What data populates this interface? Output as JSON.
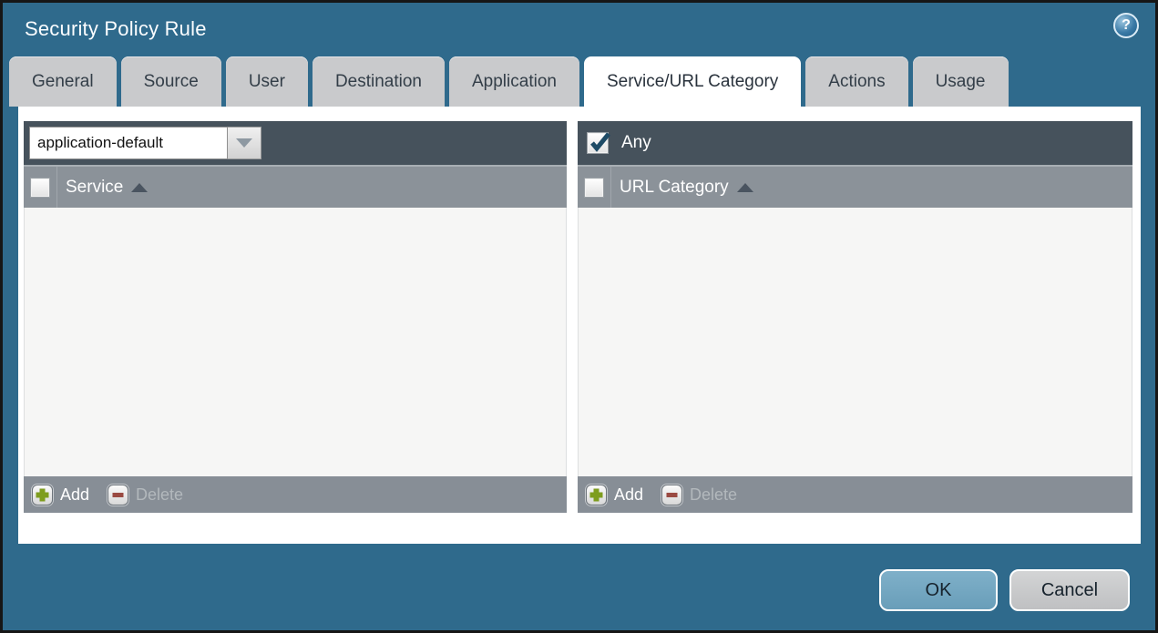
{
  "title_bar": {
    "title": "Security Policy Rule",
    "help_icon": "help-question-icon"
  },
  "tabs": [
    {
      "label": "General",
      "active": false
    },
    {
      "label": "Source",
      "active": false
    },
    {
      "label": "User",
      "active": false
    },
    {
      "label": "Destination",
      "active": false
    },
    {
      "label": "Application",
      "active": false
    },
    {
      "label": "Service/URL Category",
      "active": true
    },
    {
      "label": "Actions",
      "active": false
    },
    {
      "label": "Usage",
      "active": false
    }
  ],
  "service_panel": {
    "dropdown": {
      "value": "application-default",
      "icon": "chevron-down-icon"
    },
    "column_header": {
      "label": "Service",
      "sort": "ascending",
      "checkbox_checked": false
    },
    "rows": [],
    "footer": {
      "add_label": "Add",
      "delete_label": "Delete",
      "delete_enabled": false
    }
  },
  "url_category_panel": {
    "any_checkbox": {
      "label": "Any",
      "checked": true
    },
    "column_header": {
      "label": "URL Category",
      "sort": "ascending",
      "checkbox_checked": false
    },
    "rows": [],
    "footer": {
      "add_label": "Add",
      "delete_label": "Delete",
      "delete_enabled": false
    }
  },
  "dialog_buttons": {
    "ok_label": "OK",
    "cancel_label": "Cancel"
  },
  "colors": {
    "window_background": "#2F6A8C",
    "window_border": "#161616",
    "panel_topbar": "#46525C",
    "column_header": "#8B9299",
    "panel_body": "#F6F6F5",
    "footer_bar": "#878E96",
    "inactive_tab": "#C9CACC",
    "active_tab": "#FFFFFF",
    "ok_button": "#73A7C1",
    "cancel_button": "#C9CACB",
    "add_icon_green": "#7E9D1E",
    "delete_icon_red": "#9A4A42",
    "checkmark_navy": "#1E4B66"
  }
}
